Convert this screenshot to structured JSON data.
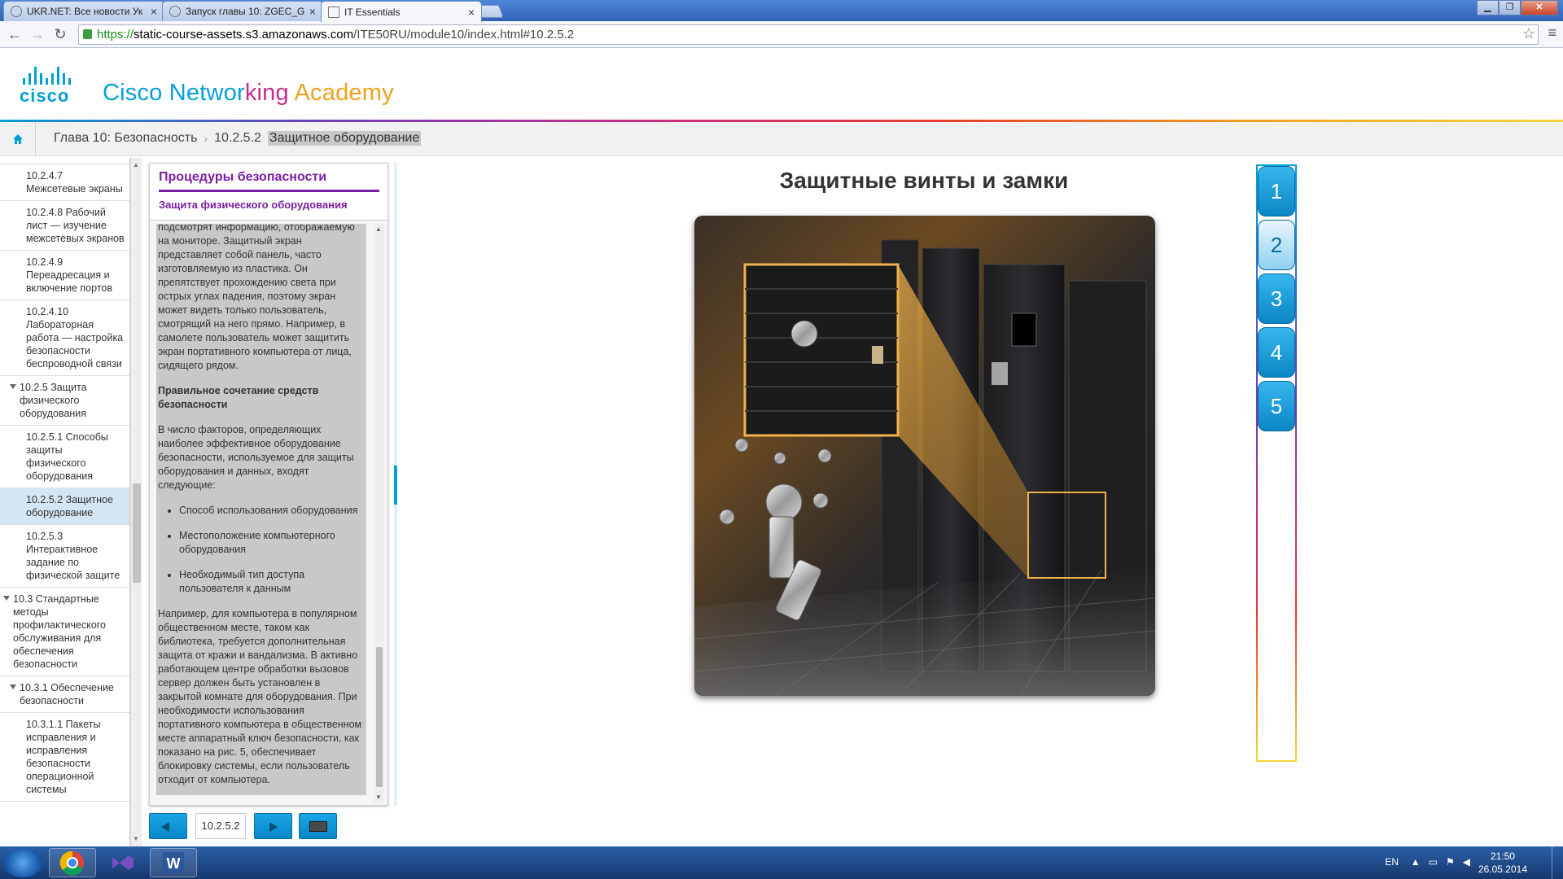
{
  "browser": {
    "tabs": [
      {
        "title": "UKR.NET: Все новости Ук",
        "active": false
      },
      {
        "title": "Запуск главы 10: ZGEC_G",
        "active": false
      },
      {
        "title": "IT Essentials",
        "active": true
      }
    ],
    "url_scheme": "https://",
    "url_host": "static-course-assets.s3.amazonaws.com",
    "url_path": "/ITE50RU/module10/index.html#10.2.5.2"
  },
  "header": {
    "logo_text": "cisco",
    "academy": {
      "part1": "Cisco Networ",
      "part2": "king ",
      "part3": "Academy"
    }
  },
  "breadcrumb": {
    "chapter": "Глава 10: Безопасность",
    "section_number": "10.2.5.2",
    "section_title": "Защитное оборудование"
  },
  "toc": {
    "items": [
      {
        "text": "10.2.4.7 Межсетевые экраны",
        "level": 3,
        "selected": false
      },
      {
        "text": "10.2.4.8 Рабочий лист — изучение межсетевых экранов",
        "level": 3,
        "selected": false
      },
      {
        "text": "10.2.4.9 Переадресация и включение портов",
        "level": 3,
        "selected": false
      },
      {
        "text": "10.2.4.10 Лабораторная работа — настройка безопасности беспроводной связи",
        "level": 3,
        "selected": false
      },
      {
        "text": "10.2.5 Защита физического оборудования",
        "level": 2,
        "selected": false,
        "expanded": true
      },
      {
        "text": "10.2.5.1 Способы защиты физического оборудования",
        "level": 3,
        "selected": false
      },
      {
        "text": "10.2.5.2 Защитное оборудование",
        "level": 3,
        "selected": true
      },
      {
        "text": "10.2.5.3 Интерактивное задание по физической защите",
        "level": 3,
        "selected": false
      },
      {
        "text": "10.3 Стандартные методы профилактического обслуживания для обеспечения безопасности",
        "level": 1,
        "selected": false,
        "expanded": true
      },
      {
        "text": "10.3.1 Обеспечение безопасности",
        "level": 2,
        "selected": false,
        "expanded": true
      },
      {
        "text": "10.3.1.1 Пакеты исправления и исправления безопасности операционной системы",
        "level": 3,
        "selected": false
      }
    ]
  },
  "text_panel": {
    "title": "Процедуры безопасности",
    "subtitle": "Защита физического оборудования",
    "para1": "подсмотрят информацию, отображаемую на мониторе. Защитный экран представляет собой панель, часто изготовляемую из пластика. Он препятствует прохождению света при острых углах падения, поэтому экран может видеть только пользователь, смотрящий на него прямо. Например, в самолете пользователь может защитить экран портативного компьютера от лица, сидящего рядом.",
    "heading": "Правильное сочетание средств безопасности",
    "para2": "В число факторов, определяющих наиболее эффективное оборудование безопасности, используемое для защиты оборудования и данных, входят следующие:",
    "bullets": [
      "Способ использования оборудования",
      "Местоположение компьютерного оборудования",
      "Необходимый тип доступа пользователя к данным"
    ],
    "para3": "Например, для компьютера в популярном общественном месте, таком как библиотека, требуется дополнительная защита от кражи и вандализма. В активно работающем центре обработки вызовов сервер должен быть установлен в закрытой комнате для оборудования. При необходимости использования портативного компьютера в общественном месте аппаратный ключ безопасности, как показано на рис. 5, обеспечивает блокировку системы, если пользователь отходит от компьютера."
  },
  "bottom_nav": {
    "page": "10.2.5.2"
  },
  "content": {
    "title": "Защитные винты и замки",
    "figure_tabs": [
      "1",
      "2",
      "3",
      "4",
      "5"
    ],
    "active_tab": "2"
  },
  "taskbar": {
    "lang": "EN",
    "time": "21:50",
    "date": "26.05.2014"
  },
  "colors": {
    "cisco_blue": "#049fd9",
    "purple": "#7b1fa2"
  }
}
